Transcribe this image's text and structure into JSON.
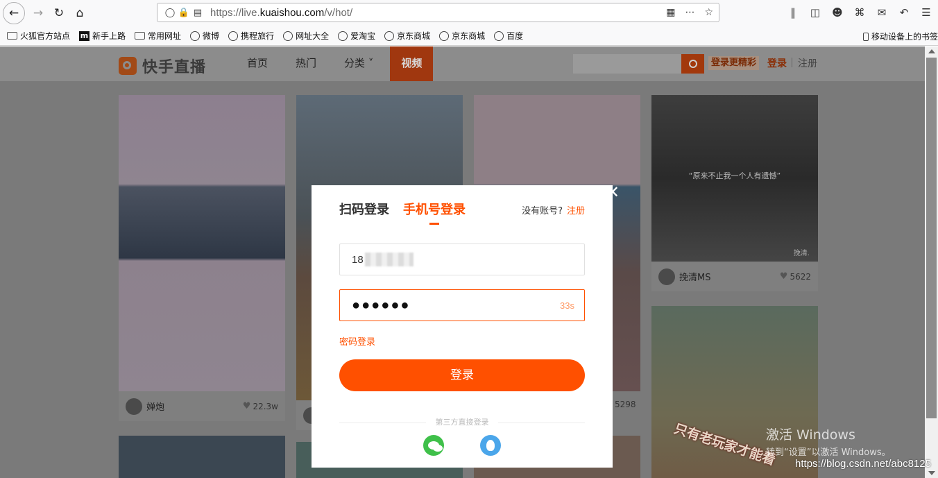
{
  "browser": {
    "url_prefix": "https://live.",
    "url_domain": "kuaishou.com",
    "url_path": "/v/hot/",
    "bookmarks": [
      "火狐官方站点",
      "新手上路",
      "常用网址",
      "微博",
      "携程旅行",
      "网址大全",
      "爱淘宝",
      "京东商城",
      "京东商城",
      "百度"
    ],
    "mobile_bookmarks": "移动设备上的书签"
  },
  "site": {
    "logo_text": "快手直播",
    "nav": [
      "首页",
      "热门",
      "分类",
      "视频"
    ],
    "promo": "登录更精彩",
    "login_label": "登录",
    "register_label": "注册"
  },
  "cards": [
    {
      "user": "婵炮",
      "likes": "22.3w"
    },
    {
      "user": "",
      "likes": ""
    },
    {
      "user": "",
      "likes": "5298"
    },
    {
      "user": "挽清MS",
      "likes": "5622",
      "quote": "“原来不止我一个人有遗憾”",
      "mark": "挽清."
    },
    {
      "overlay": "只有老玩家才能看"
    }
  ],
  "modal": {
    "tab_qr": "扫码登录",
    "tab_phone": "手机号登录",
    "no_account": "没有账号?",
    "register": "注册",
    "phone_prefix": "18",
    "code_masked": "●●●●●●",
    "countdown": "33s",
    "password_login": "密码登录",
    "login_button": "登录",
    "third_party": "第三方直接登录"
  },
  "overlay": {
    "activate_title": "激活 Windows",
    "activate_sub": "转到“设置”以激活 Windows。",
    "csdn": "https://blog.csdn.net/abc8125"
  }
}
